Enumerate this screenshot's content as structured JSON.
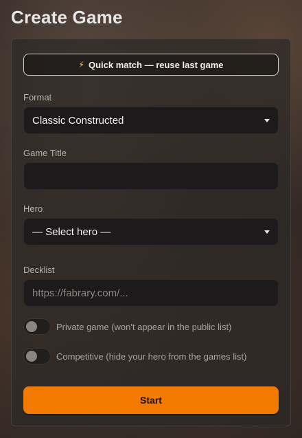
{
  "page": {
    "title": "Create Game"
  },
  "quick_match": {
    "icon": "lightning-bolt-icon",
    "glyph": "⚡",
    "label": "Quick match — reuse last game"
  },
  "format": {
    "label": "Format",
    "value": "Classic Constructed"
  },
  "game_title": {
    "label": "Game Title",
    "value": ""
  },
  "hero": {
    "label": "Hero",
    "value": "— Select hero —"
  },
  "decklist": {
    "label": "Decklist",
    "placeholder": "https://fabrary.com/..."
  },
  "private_toggle": {
    "label": "Private game (won't appear in the public list)",
    "on": false
  },
  "competitive_toggle": {
    "label": "Competitive (hide your hero from the games list)",
    "on": false
  },
  "start": {
    "label": "Start"
  },
  "colors": {
    "accent": "#f27a00",
    "bolt": "#ffd33d"
  }
}
